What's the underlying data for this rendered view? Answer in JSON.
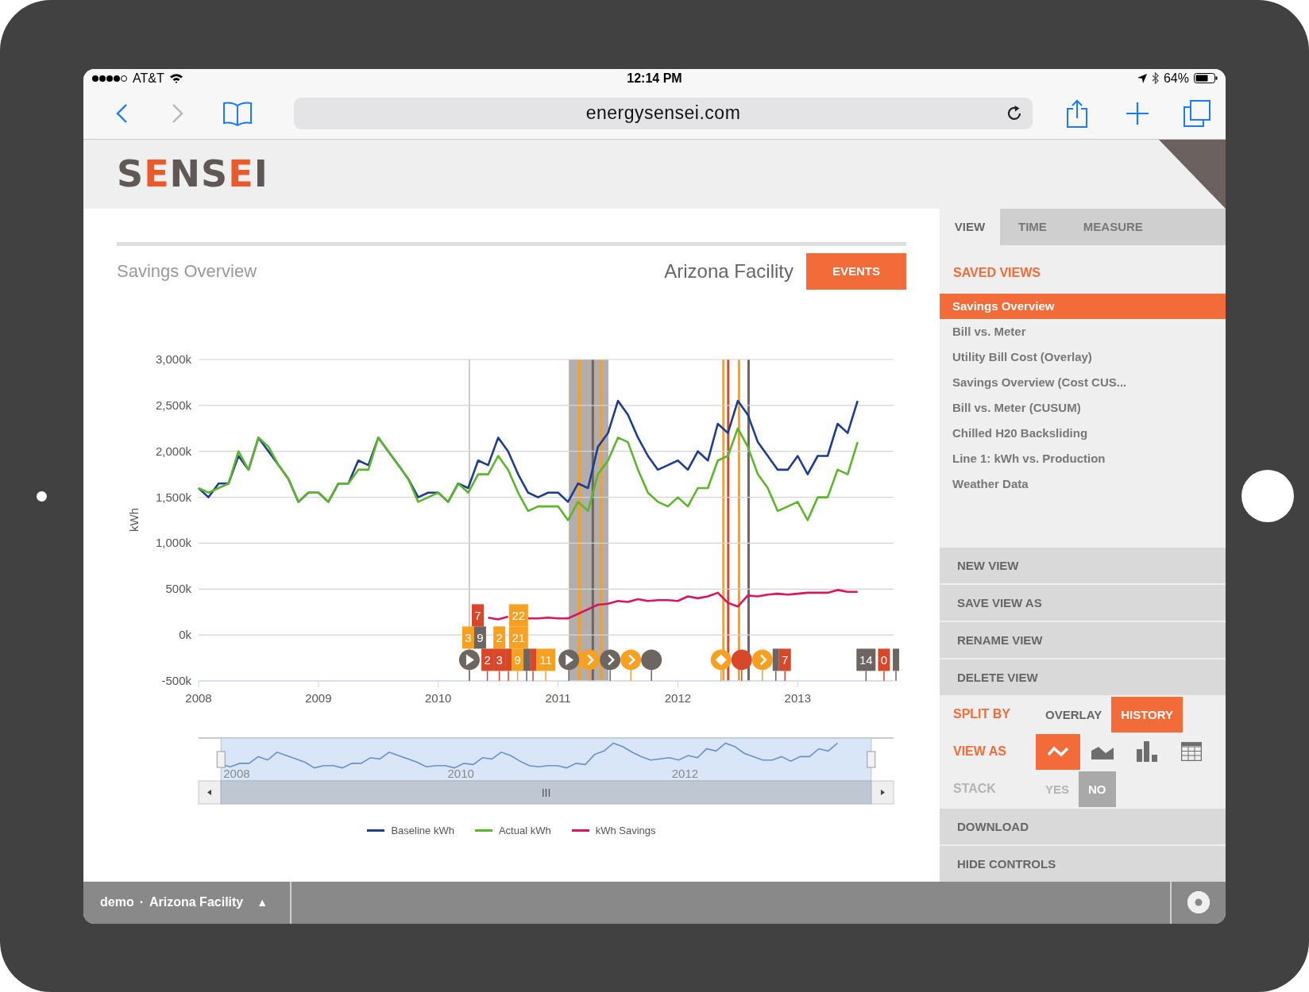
{
  "status_bar": {
    "carrier": "AT&T",
    "time": "12:14 PM",
    "battery": "64%"
  },
  "browser": {
    "url": "energysensei.com"
  },
  "app": {
    "logo": "SENSEI"
  },
  "report": {
    "title": "Savings Overview",
    "facility": "Arizona Facility",
    "events_button": "EVENTS",
    "chart_data": {
      "type": "line",
      "ylabel": "kWh",
      "grid": true,
      "xlim": [
        2008,
        2013.8
      ],
      "ylim": [
        -500,
        3000
      ],
      "xticks": [
        2008,
        2009,
        2010,
        2011,
        2012,
        2013
      ],
      "yticks": [
        {
          "value": -500,
          "label": "-500k"
        },
        {
          "value": 0,
          "label": "0k"
        },
        {
          "value": 500,
          "label": "500k"
        },
        {
          "value": 1000,
          "label": "1,000k"
        },
        {
          "value": 1500,
          "label": "1,500k"
        },
        {
          "value": 2000,
          "label": "2,000k"
        },
        {
          "value": 2500,
          "label": "2,500k"
        },
        {
          "value": 3000,
          "label": "3,000k"
        }
      ],
      "x": [
        2008,
        2008.083,
        2008.167,
        2008.25,
        2008.333,
        2008.417,
        2008.5,
        2008.583,
        2008.667,
        2008.75,
        2008.833,
        2008.917,
        2009,
        2009.083,
        2009.167,
        2009.25,
        2009.333,
        2009.417,
        2009.5,
        2009.583,
        2009.667,
        2009.75,
        2009.833,
        2009.917,
        2010,
        2010.083,
        2010.167,
        2010.25,
        2010.333,
        2010.417,
        2010.5,
        2010.583,
        2010.667,
        2010.75,
        2010.833,
        2010.917,
        2011,
        2011.083,
        2011.167,
        2011.25,
        2011.333,
        2011.417,
        2011.5,
        2011.583,
        2011.667,
        2011.75,
        2011.833,
        2011.917,
        2012,
        2012.083,
        2012.167,
        2012.25,
        2012.333,
        2012.417,
        2012.5,
        2012.583,
        2012.667,
        2012.75,
        2012.833,
        2012.917,
        2013,
        2013.083,
        2013.167,
        2013.25,
        2013.333,
        2013.417,
        2013.5
      ],
      "series": [
        {
          "name": "Baseline kWh",
          "color": "#1f3d8f",
          "values": [
            1600,
            1500,
            1650,
            1650,
            1950,
            1800,
            2150,
            2000,
            1850,
            1700,
            1450,
            1550,
            1550,
            1450,
            1650,
            1650,
            1900,
            1850,
            2150,
            2000,
            1850,
            1700,
            1500,
            1550,
            1550,
            1450,
            1650,
            1600,
            1900,
            1850,
            2150,
            2000,
            1750,
            1550,
            1500,
            1550,
            1550,
            1450,
            1650,
            1600,
            2050,
            2200,
            2550,
            2400,
            2150,
            1950,
            1800,
            1850,
            1900,
            1800,
            2000,
            1900,
            2300,
            2200,
            2550,
            2400,
            2100,
            1950,
            1800,
            1800,
            1950,
            1750,
            1950,
            1950,
            2300,
            2200,
            2550
          ]
        },
        {
          "name": "Actual kWh",
          "color": "#5db52c",
          "values": [
            1600,
            1550,
            1600,
            1650,
            2000,
            1800,
            2150,
            2050,
            1850,
            1700,
            1450,
            1550,
            1550,
            1450,
            1650,
            1650,
            1800,
            1800,
            2150,
            2000,
            1850,
            1700,
            1450,
            1500,
            1550,
            1450,
            1650,
            1550,
            1750,
            1750,
            1950,
            1800,
            1550,
            1350,
            1400,
            1400,
            1400,
            1250,
            1450,
            1350,
            1750,
            1900,
            2150,
            2100,
            1800,
            1550,
            1450,
            1400,
            1500,
            1400,
            1600,
            1600,
            1900,
            1950,
            2250,
            2050,
            1750,
            1600,
            1350,
            1400,
            1450,
            1250,
            1500,
            1500,
            1800,
            1750,
            2100
          ]
        },
        {
          "name": "kWh Savings",
          "color": "#d9155e",
          "values": [
            null,
            null,
            null,
            null,
            null,
            null,
            null,
            null,
            null,
            null,
            null,
            null,
            null,
            null,
            null,
            null,
            null,
            null,
            null,
            null,
            null,
            null,
            null,
            null,
            null,
            null,
            null,
            null,
            null,
            190,
            170,
            200,
            null,
            180,
            180,
            190,
            180,
            180,
            230,
            280,
            330,
            340,
            370,
            360,
            390,
            370,
            380,
            380,
            370,
            420,
            400,
            420,
            460,
            350,
            310,
            430,
            420,
            440,
            450,
            440,
            450,
            460,
            460,
            460,
            490,
            470,
            470
          ]
        }
      ]
    },
    "events": [
      {
        "kind": "flag",
        "text": "7",
        "color": "#d9472b"
      },
      {
        "kind": "flag",
        "text": "22",
        "color": "#f7a021"
      },
      {
        "kind": "flag",
        "text": "3",
        "color": "#f7a021"
      },
      {
        "kind": "flag",
        "text": "9",
        "color": "#6d6562"
      },
      {
        "kind": "flag",
        "text": "2",
        "color": "#f7a021"
      },
      {
        "kind": "flag",
        "text": "21",
        "color": "#f7a021"
      },
      {
        "kind": "play",
        "color": "#6d6562"
      },
      {
        "kind": "flag",
        "text": "2",
        "color": "#d9472b"
      },
      {
        "kind": "flag",
        "text": "3",
        "color": "#d9472b"
      },
      {
        "kind": "flag",
        "color": "#d9472b"
      },
      {
        "kind": "flag",
        "text": "9",
        "color": "#f7a021"
      },
      {
        "kind": "flag",
        "color": "#6d6562"
      },
      {
        "kind": "flag",
        "color": "#d9472b"
      },
      {
        "kind": "flag",
        "text": "11",
        "color": "#f7a021"
      },
      {
        "kind": "play",
        "color": "#6d6562"
      },
      {
        "kind": "arrow",
        "color": "#f7a021"
      },
      {
        "kind": "arrow",
        "color": "#6d6562"
      },
      {
        "kind": "arrow",
        "color": "#f7a021"
      },
      {
        "kind": "dot",
        "color": "#6d6562"
      },
      {
        "kind": "diamond",
        "color": "#f7a021"
      },
      {
        "kind": "dot",
        "color": "#d9472b"
      },
      {
        "kind": "arrow",
        "color": "#f7a021"
      },
      {
        "kind": "flag",
        "color": "#6d6562"
      },
      {
        "kind": "flag",
        "text": "7",
        "color": "#d9472b"
      },
      {
        "kind": "flag",
        "text": "14",
        "color": "#6d6562"
      },
      {
        "kind": "flag",
        "text": "0",
        "color": "#d9472b"
      },
      {
        "kind": "flag",
        "color": "#6d6562"
      }
    ],
    "navigator": {
      "grip": "III",
      "labels": [
        "2008",
        "2010",
        "2012"
      ]
    }
  },
  "controls": {
    "tabs": [
      {
        "label": "VIEW",
        "selected": true
      },
      {
        "label": "TIME",
        "selected": false
      },
      {
        "label": "MEASURE",
        "selected": false
      }
    ],
    "saved_views_heading": "SAVED VIEWS",
    "saved_views": [
      {
        "label": "Savings Overview",
        "selected": true
      },
      {
        "label": "Bill vs. Meter",
        "selected": false
      },
      {
        "label": "Utility Bill Cost (Overlay)",
        "selected": false
      },
      {
        "label": "Savings Overview (Cost CUS...",
        "selected": false
      },
      {
        "label": "Bill vs. Meter (CUSUM)",
        "selected": false
      },
      {
        "label": "Chilled H20 Backsliding",
        "selected": false
      },
      {
        "label": "Line 1: kWh vs. Production",
        "selected": false
      },
      {
        "label": "Weather Data",
        "selected": false
      }
    ],
    "actions": [
      "NEW VIEW",
      "SAVE VIEW AS",
      "RENAME VIEW",
      "DELETE VIEW"
    ],
    "split_by": {
      "label": "SPLIT BY",
      "options": [
        {
          "label": "OVERLAY",
          "selected": false
        },
        {
          "label": "HISTORY",
          "selected": true
        }
      ]
    },
    "view_as": {
      "label": "VIEW AS",
      "options": [
        {
          "kind": "line",
          "selected": true
        },
        {
          "kind": "area",
          "selected": false
        },
        {
          "kind": "bar",
          "selected": false
        },
        {
          "kind": "table",
          "selected": false
        }
      ]
    },
    "stack": {
      "label": "STACK",
      "disabled": true,
      "options": [
        {
          "label": "YES",
          "selected": false
        },
        {
          "label": "NO",
          "selected": true
        }
      ]
    },
    "bottom_actions": [
      "DOWNLOAD",
      "HIDE CONTROLS"
    ]
  },
  "footer": {
    "user": "demo",
    "separator": "·",
    "facility": "Arizona Facility",
    "caret": "▲"
  }
}
